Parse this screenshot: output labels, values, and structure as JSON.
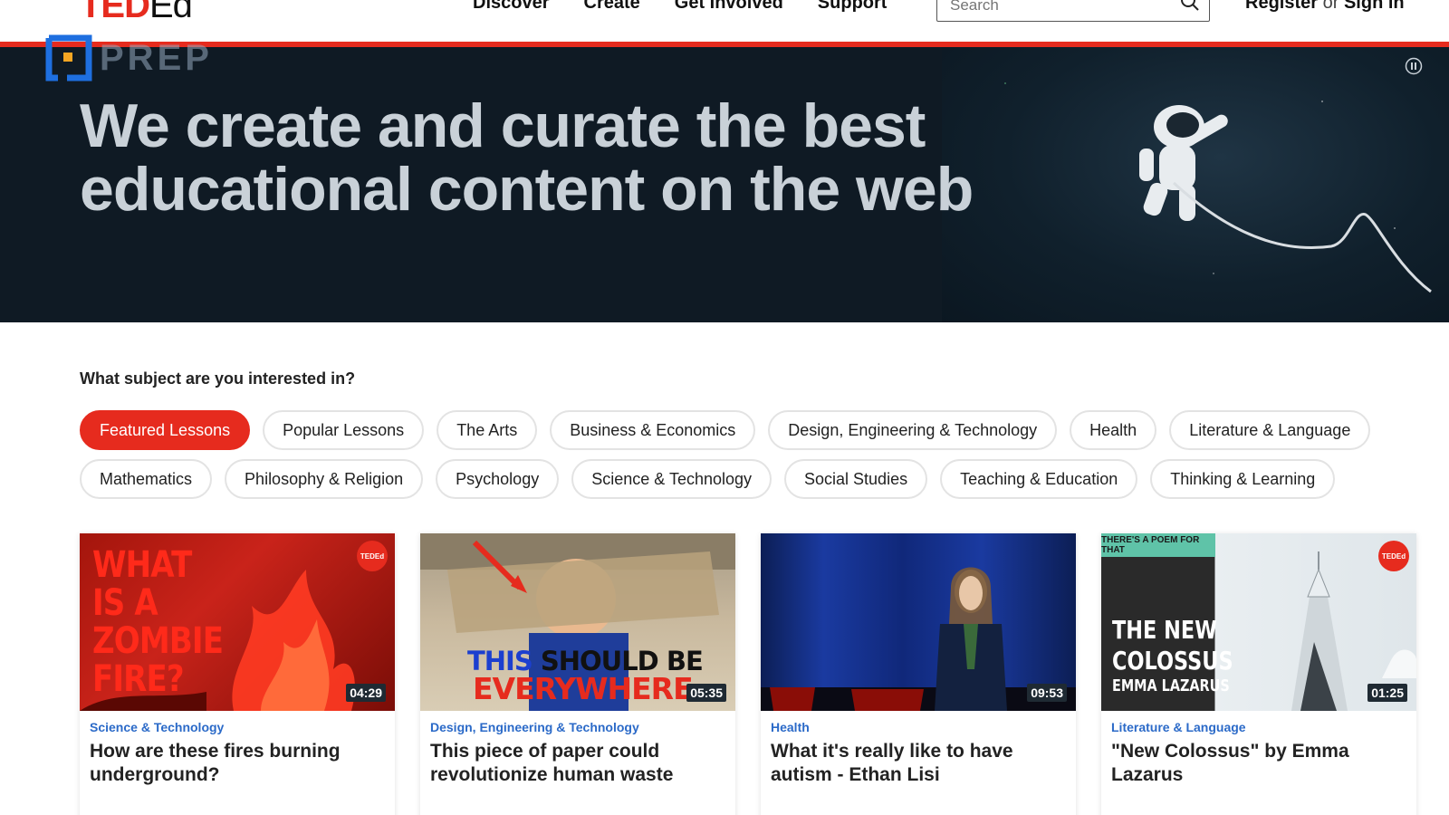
{
  "header": {
    "logo_ted": "TED",
    "logo_ed": "Ed",
    "nav": [
      "Discover",
      "Create",
      "Get Involved",
      "Support"
    ],
    "search_placeholder": "Search",
    "register": "Register",
    "or": "or",
    "signin": "Sign in"
  },
  "watermark": {
    "text": "PREP"
  },
  "hero": {
    "headline": "We create and curate the best educational content on the web"
  },
  "subjects": {
    "question": "What subject are you interested in?",
    "row1": [
      "Featured Lessons",
      "Popular Lessons",
      "The Arts",
      "Business & Economics",
      "Design, Engineering & Technology",
      "Health",
      "Literature & Language"
    ],
    "row2": [
      "Mathematics",
      "Philosophy & Religion",
      "Psychology",
      "Science & Technology",
      "Social Studies",
      "Teaching & Education",
      "Thinking & Learning"
    ],
    "active": "Featured Lessons"
  },
  "cards": [
    {
      "category": "Science & Technology",
      "title": "How are these fires burning underground?",
      "duration": "04:29",
      "thumb_text": "WHAT IS A ZOMBIE FIRE?",
      "badge": "TEDEd"
    },
    {
      "category": "Design, Engineering & Technology",
      "title": "This piece of paper could revolutionize human waste",
      "duration": "05:35",
      "thumb_line1_a": "THIS",
      "thumb_line1_b": "SHOULD BE",
      "thumb_line2": "EVERYWHERE"
    },
    {
      "category": "Health",
      "title": "What it's really like to have autism - Ethan Lisi",
      "duration": "09:53"
    },
    {
      "category": "Literature & Language",
      "title": "\"New Colossus\" by Emma Lazarus",
      "duration": "01:25",
      "thumb_tag": "THERE'S A POEM FOR THAT",
      "thumb_title": "THE NEW COLOSSUS",
      "thumb_author": "EMMA LAZARUS",
      "badge": "TEDEd"
    }
  ],
  "colors": {
    "brand_red": "#e62b1e",
    "hero_bg": "#0f1a24",
    "category_blue": "#2b6ac8"
  },
  "icons": {
    "search": "search-icon",
    "pause": "pause-icon"
  }
}
